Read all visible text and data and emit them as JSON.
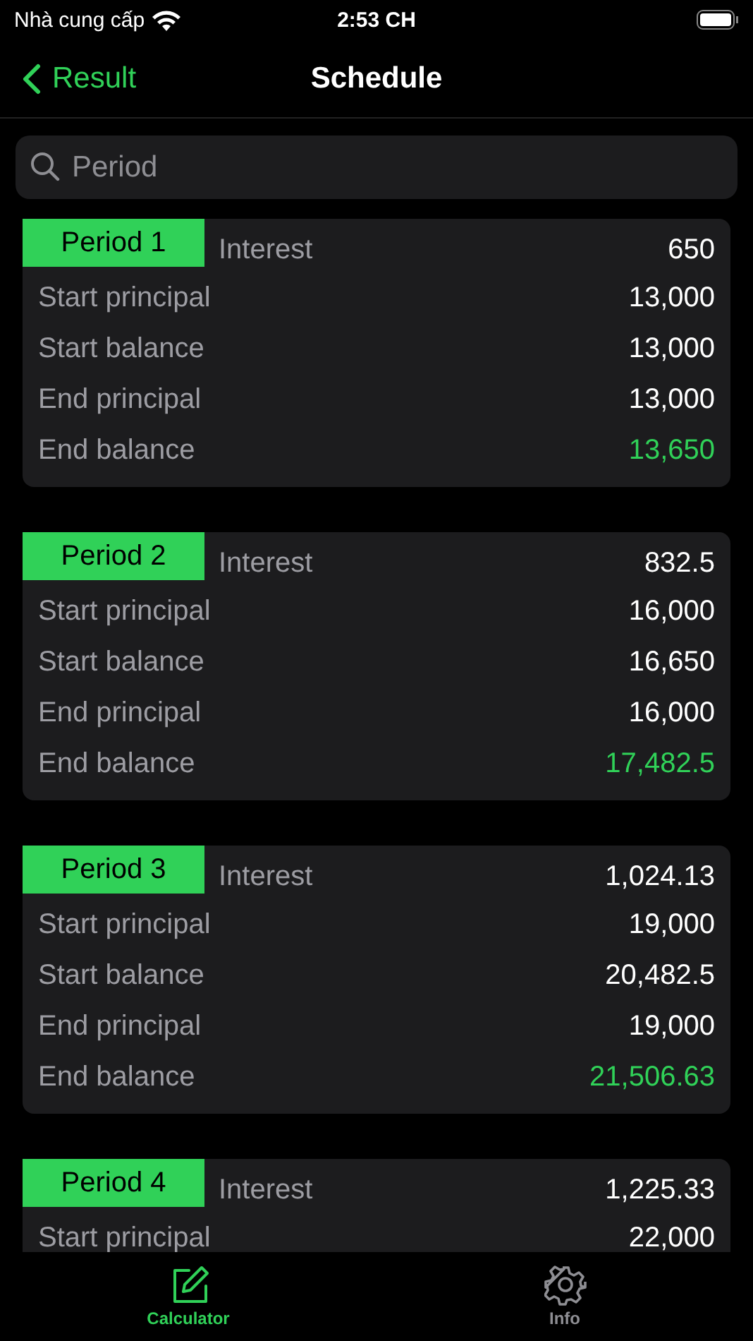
{
  "status_bar": {
    "carrier": "Nhà cung cấp",
    "time": "2:53 CH"
  },
  "nav": {
    "back": "Result",
    "title": "Schedule"
  },
  "search": {
    "placeholder": "Period"
  },
  "periods": [
    {
      "badge": "Period 1",
      "rows": [
        {
          "label": "Interest",
          "value": "650",
          "highlighted": false
        },
        {
          "label": "Start principal",
          "value": "13,000",
          "highlighted": false
        },
        {
          "label": "Start balance",
          "value": "13,000",
          "highlighted": false
        },
        {
          "label": "End principal",
          "value": "13,000",
          "highlighted": false
        },
        {
          "label": "End balance",
          "value": "13,650",
          "highlighted": true
        }
      ]
    },
    {
      "badge": "Period 2",
      "rows": [
        {
          "label": "Interest",
          "value": "832.5",
          "highlighted": false
        },
        {
          "label": "Start principal",
          "value": "16,000",
          "highlighted": false
        },
        {
          "label": "Start balance",
          "value": "16,650",
          "highlighted": false
        },
        {
          "label": "End principal",
          "value": "16,000",
          "highlighted": false
        },
        {
          "label": "End balance",
          "value": "17,482.5",
          "highlighted": true
        }
      ]
    },
    {
      "badge": "Period 3",
      "rows": [
        {
          "label": "Interest",
          "value": "1,024.13",
          "highlighted": false
        },
        {
          "label": "Start principal",
          "value": "19,000",
          "highlighted": false
        },
        {
          "label": "Start balance",
          "value": "20,482.5",
          "highlighted": false
        },
        {
          "label": "End principal",
          "value": "19,000",
          "highlighted": false
        },
        {
          "label": "End balance",
          "value": "21,506.63",
          "highlighted": true
        }
      ]
    },
    {
      "badge": "Period 4",
      "rows": [
        {
          "label": "Interest",
          "value": "1,225.33",
          "highlighted": false
        },
        {
          "label": "Start principal",
          "value": "22,000",
          "highlighted": false
        }
      ]
    }
  ],
  "tabs": [
    {
      "label": "Calculator",
      "kind": "edit",
      "selected": true
    },
    {
      "label": "Info",
      "kind": "gear",
      "selected": false
    }
  ]
}
